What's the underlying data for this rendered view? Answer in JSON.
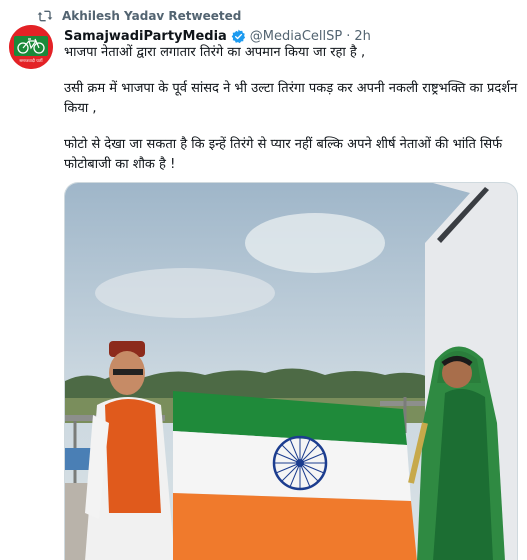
{
  "retweet": {
    "icon": "retweet-icon",
    "label": "Akhilesh Yadav Retweeted"
  },
  "tweet": {
    "author": {
      "name": "SamajwadiPartyMedia",
      "handle": "@MediaCellSP",
      "verified": true,
      "avatar_icon": "samajwadi-party-cycle-logo",
      "avatar_caption": "समाजवादी पार्टी"
    },
    "separator": "·",
    "time": "2h",
    "paragraphs": [
      "भाजपा नेताओं द्वारा लगातार तिरंगे का अपमान किया जा रहा है ,",
      "उसी क्रम में भाजपा के पूर्व सांसद ने भी उल्टा तिरंगा पकड़ कर अपनी नकली राष्ट्रभक्ति का प्रदर्शन किया ,",
      "फोटो से देखा जा सकता है कि इन्हें तिरंगे से प्यार नहीं बल्कि अपने शीर्ष नेताओं की भांति सिर्फ फोटोबाजी का शौक है !"
    ]
  },
  "colors": {
    "accent": "#1d9bf0",
    "text": "#0f1419",
    "muted": "#536471",
    "avatar_bg": "#e32226"
  }
}
